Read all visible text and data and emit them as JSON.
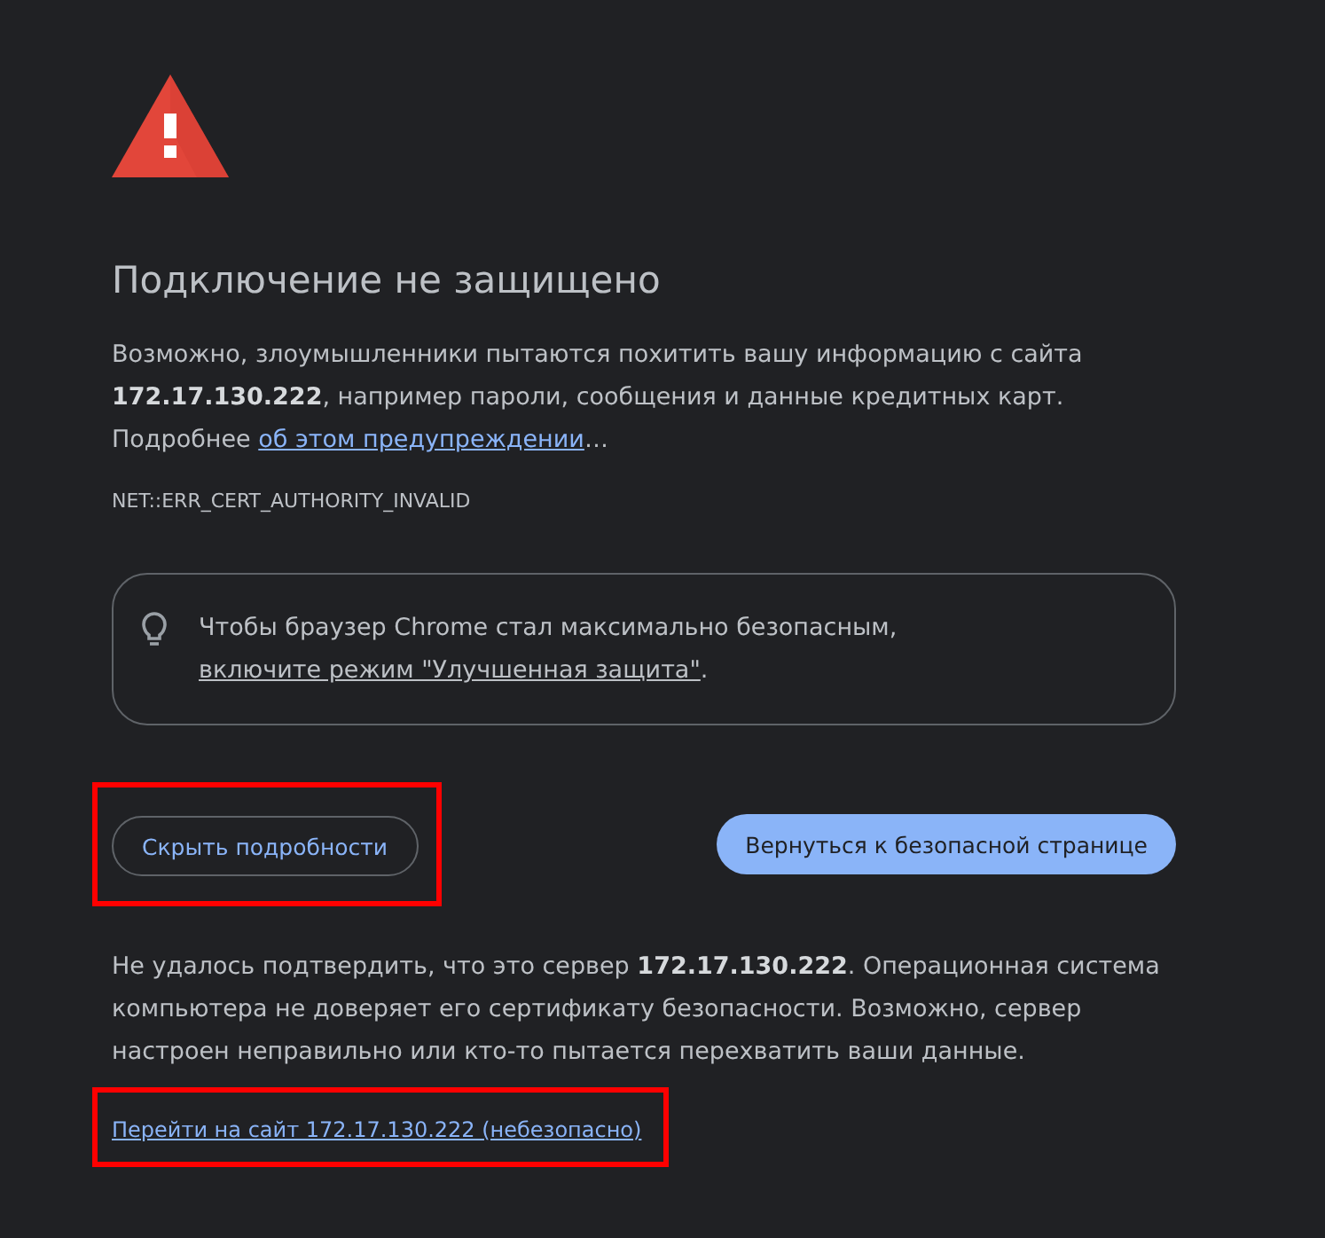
{
  "title": "Подключение не защищено",
  "intro": {
    "text": "Возможно, злоумышленники пытаются похитить вашу информацию с сайта **172.17.130.222**, например пароли, сообщения и данные кредитных карт. Подробнее",
    "link": "об этом предупреждении",
    "after": "…"
  },
  "error_code": "NET::ERR_CERT_AUTHORITY_INVALID",
  "hint": {
    "text": "Чтобы браузер Chrome стал максимально безопасным,",
    "link": "включите режим \"Улучшенная защита\"",
    "after": "."
  },
  "buttons": [
    {
      "label": "Скрыть подробности",
      "kind": "secondary",
      "highlighted": true
    },
    {
      "label": "Вернуться к безопасной странице",
      "kind": "primary",
      "highlighted": false
    }
  ],
  "details": "Не удалось подтвердить, что это сервер **172.17.130.222**. Операционная система компьютера не доверяет его сертификату безопасности. Возможно, сервер настроен неправильно или кто-то пытается перехватить ваши данные.",
  "proceed_link": {
    "label": "Перейти на сайт 172.17.130.222 (небезопасно)",
    "highlighted": true
  }
}
